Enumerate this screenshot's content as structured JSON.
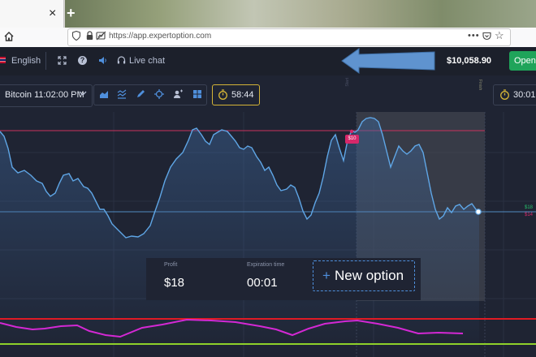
{
  "browser": {
    "tab_close": "×",
    "new_tab": "+",
    "url": "https://app.expertoption.com",
    "url_more": "•••"
  },
  "header": {
    "language": "English",
    "help": "?",
    "live_chat": "Live chat",
    "balance": "$10,058.90",
    "open_button": "Open"
  },
  "toolbar": {
    "asset": "Bitcoin 11:02:00 PM",
    "timer": "58:44",
    "timer_secondary": "30:01"
  },
  "chart_labels": {
    "start": "Start",
    "finish": "Finish",
    "price_tag_high": "$10",
    "tag_up": "$18",
    "tag_down": "$14"
  },
  "option_panel": {
    "profit_label": "Profit",
    "profit_value": "$18",
    "expiration_label": "Expiration time",
    "expiration_value": "00:01",
    "new_option_plus": "+",
    "new_option_label": "New option"
  },
  "colors": {
    "price_line": "#5fa6e6",
    "target_line": "#c9325e",
    "indicator_red": "#e01b24",
    "indicator_magenta": "#d428d4",
    "indicator_green": "#8fd12a",
    "accent_blue": "#4f8fdc",
    "open_green": "#1fa45a"
  },
  "icons": [
    "home-icon",
    "shield-icon",
    "lock-icon",
    "permission-icon",
    "pocket-icon",
    "star-icon",
    "fullscreen-icon",
    "help-icon",
    "sound-icon",
    "headset-icon",
    "chevron-down-icon",
    "chart-type-icon",
    "indicators-icon",
    "draw-icon",
    "crosshair-icon",
    "social-icon",
    "layout-icon",
    "stopwatch-icon"
  ]
}
